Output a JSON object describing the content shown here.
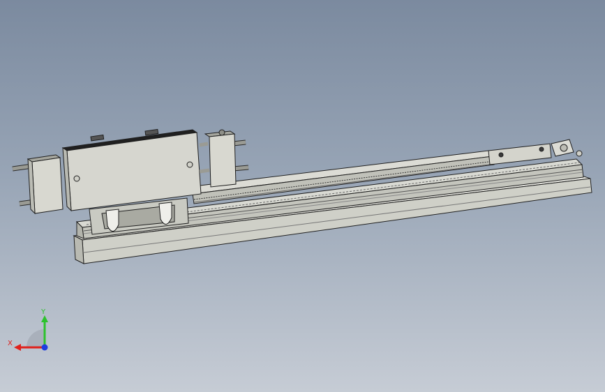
{
  "viewport": {
    "background_top": "#7b8a9f",
    "background_bottom": "#c6ccd5"
  },
  "model": {
    "description_icon": "linear-slide-actuator-model",
    "body_color": "#d6d6cf",
    "edge_color": "#1e1e1e",
    "shade_color": "#aeb0a8",
    "dark_color": "#3a3a3a"
  },
  "triad": {
    "x_label": "X",
    "y_label": "Y",
    "x_color": "#e0201b",
    "y_color": "#2cc22c",
    "z_color": "#1f3de0"
  }
}
